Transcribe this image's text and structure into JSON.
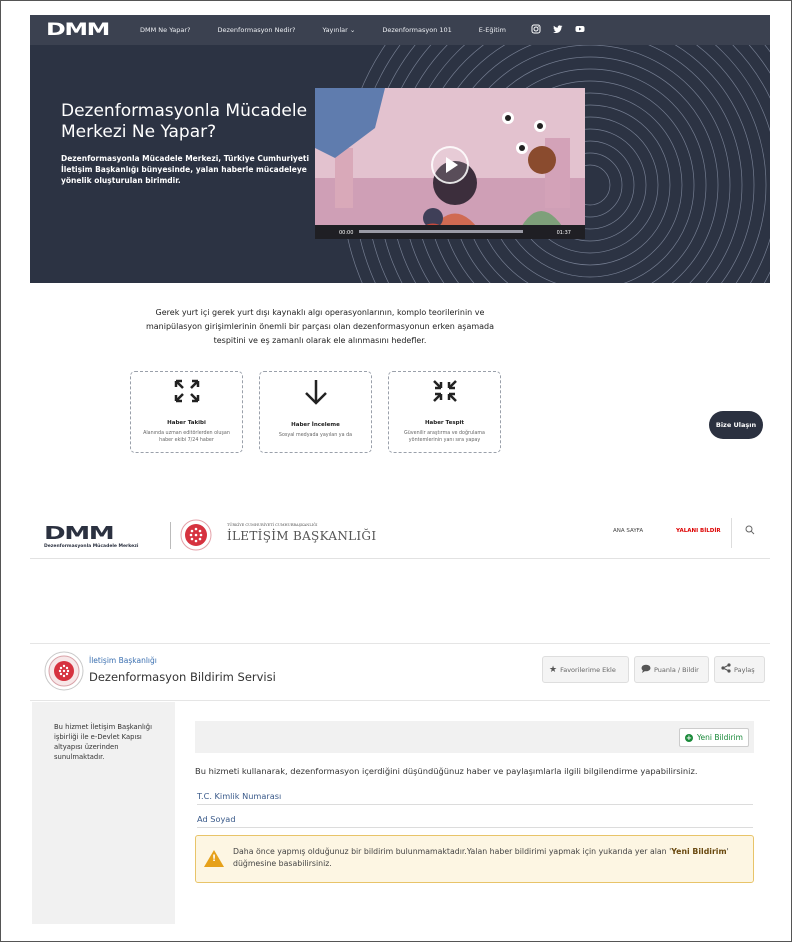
{
  "dmm_site": {
    "logo": "DMM",
    "nav": [
      "DMM Ne Yapar?",
      "Dezenformasyon Nedir?",
      "Yayınlar ⌄",
      "Dezenformasyon 101",
      "E-Eğitim"
    ],
    "social_icons": [
      "instagram-icon",
      "twitter-icon",
      "youtube-icon"
    ],
    "hero": {
      "title": "Dezenformasyonla Mücadele Merkezi Ne Yapar?",
      "text": "Dezenformasyonla Mücadele Merkezi, Türkiye Cumhuriyeti İletişim Başkanlığı bünyesinde, yalan haberle mücadeleye yönelik oluşturulan birimdir.",
      "video": {
        "current_time": "00:00",
        "duration": "01:37"
      }
    },
    "intro": "Gerek yurt içi gerek yurt dışı kaynaklı algı operasyonlarının, komplo teorilerinin ve manipülasyon girişimlerinin önemli bir parçası olan dezenformasyonun erken aşamada tespitini ve eş zamanlı olarak ele alınmasını hedefler.",
    "cards": [
      {
        "title": "Haber Takibi",
        "desc": "Alanında uzman editörlerden oluşan haber ekibi 7/24 haber",
        "icon": "expand-icon"
      },
      {
        "title": "Haber İnceleme",
        "desc": "Sosyal medyada yayılan ya da",
        "icon": "arrow-down-icon"
      },
      {
        "title": "Haber Tespit",
        "desc": "Güvenilir araştırma ve doğrulama yöntemlerinin yanı sıra yapay",
        "icon": "collapse-icon"
      }
    ],
    "contact_button": "Bize Ulaşın"
  },
  "gov_site": {
    "logo_big": "DMM",
    "logo_small": "Dezenformasyonla Mücadele Merkezi",
    "org_small": "TÜRKİYE CUMHURİYETİ CUMHURBAŞKANLIĞI",
    "org_name": "İLETİŞİM BAŞKANLIĞI",
    "nav_home": "ANA SAYFA",
    "nav_report": "YALANI BİLDİR",
    "service": {
      "org": "İletişim Başkanlığı",
      "title": "Dezenformasyon Bildirim Servisi",
      "actions": [
        "Favorilerime Ekle",
        "Puanla / Bildir",
        "Paylaş"
      ]
    },
    "sidebar_text": "Bu hizmet İletişim Başkanlığı işbirliği ile e-Devlet Kapısı altyapısı üzerinden sunulmaktadır.",
    "new_button": "Yeni Bildirim",
    "description": "Bu hizmeti kullanarak, dezenformasyon içerdiğini düşündüğünuz haber ve paylaşımlarla ilgili bilgilendirme yapabilirsiniz.",
    "field_id": "T.C. Kimlik Numarası",
    "field_name": "Ad Soyad",
    "warning_text": "Daha önce yapmış olduğunuz bir bildirim bulunmamaktadır.Yalan haber bildirimi yapmak için yukarıda yer alan '",
    "warning_bold": "Yeni Bildirim",
    "warning_tail": "' düğmesine basabilirsiniz."
  }
}
